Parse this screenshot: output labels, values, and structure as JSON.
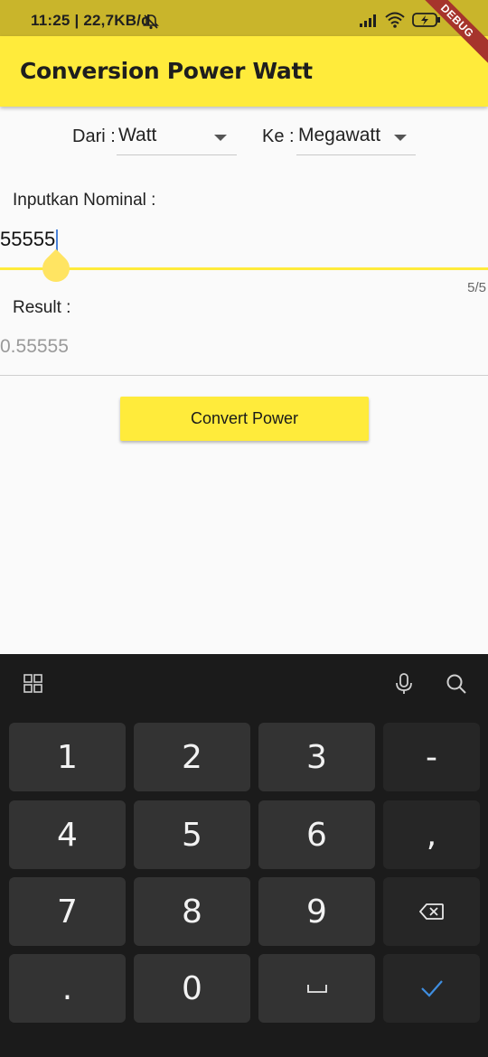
{
  "status_bar": {
    "time_speed": "11:25 | 22,7KB/d",
    "battery": "2",
    "battery_percent_symbol": "%"
  },
  "debug_banner": "DEBUG",
  "app_bar": {
    "title": "Conversion Power Watt"
  },
  "converter": {
    "from_label": "Dari :",
    "from_value": "Watt",
    "to_label": "Ke :",
    "to_value": "Megawatt"
  },
  "input": {
    "label": "Inputkan Nominal :",
    "value": "55555",
    "counter": "5/5"
  },
  "result": {
    "label": "Result :",
    "value": "0.55555"
  },
  "convert_button": {
    "label": "Convert Power"
  },
  "keyboard": {
    "toolbar_icons": [
      "grid-icon",
      "microphone-icon",
      "search-icon"
    ],
    "rows": [
      [
        "1",
        "2",
        "3",
        "-"
      ],
      [
        "4",
        "5",
        "6",
        ","
      ],
      [
        "7",
        "8",
        "9",
        "backspace"
      ],
      [
        ".",
        "0",
        "space",
        "enter"
      ]
    ],
    "labels": {
      "k1": "1",
      "k2": "2",
      "k3": "3",
      "kminus": "-",
      "k4": "4",
      "k5": "5",
      "k6": "6",
      "kcomma": ",",
      "k7": "7",
      "k8": "8",
      "k9": "9",
      "kdot": ".",
      "k0": "0"
    },
    "enter_color": "#3f8ee0"
  },
  "colors": {
    "accent": "#ffeb3b",
    "status_bar": "#c9b52b",
    "keyboard_bg": "#1b1b1b",
    "key_bg": "#333333"
  }
}
